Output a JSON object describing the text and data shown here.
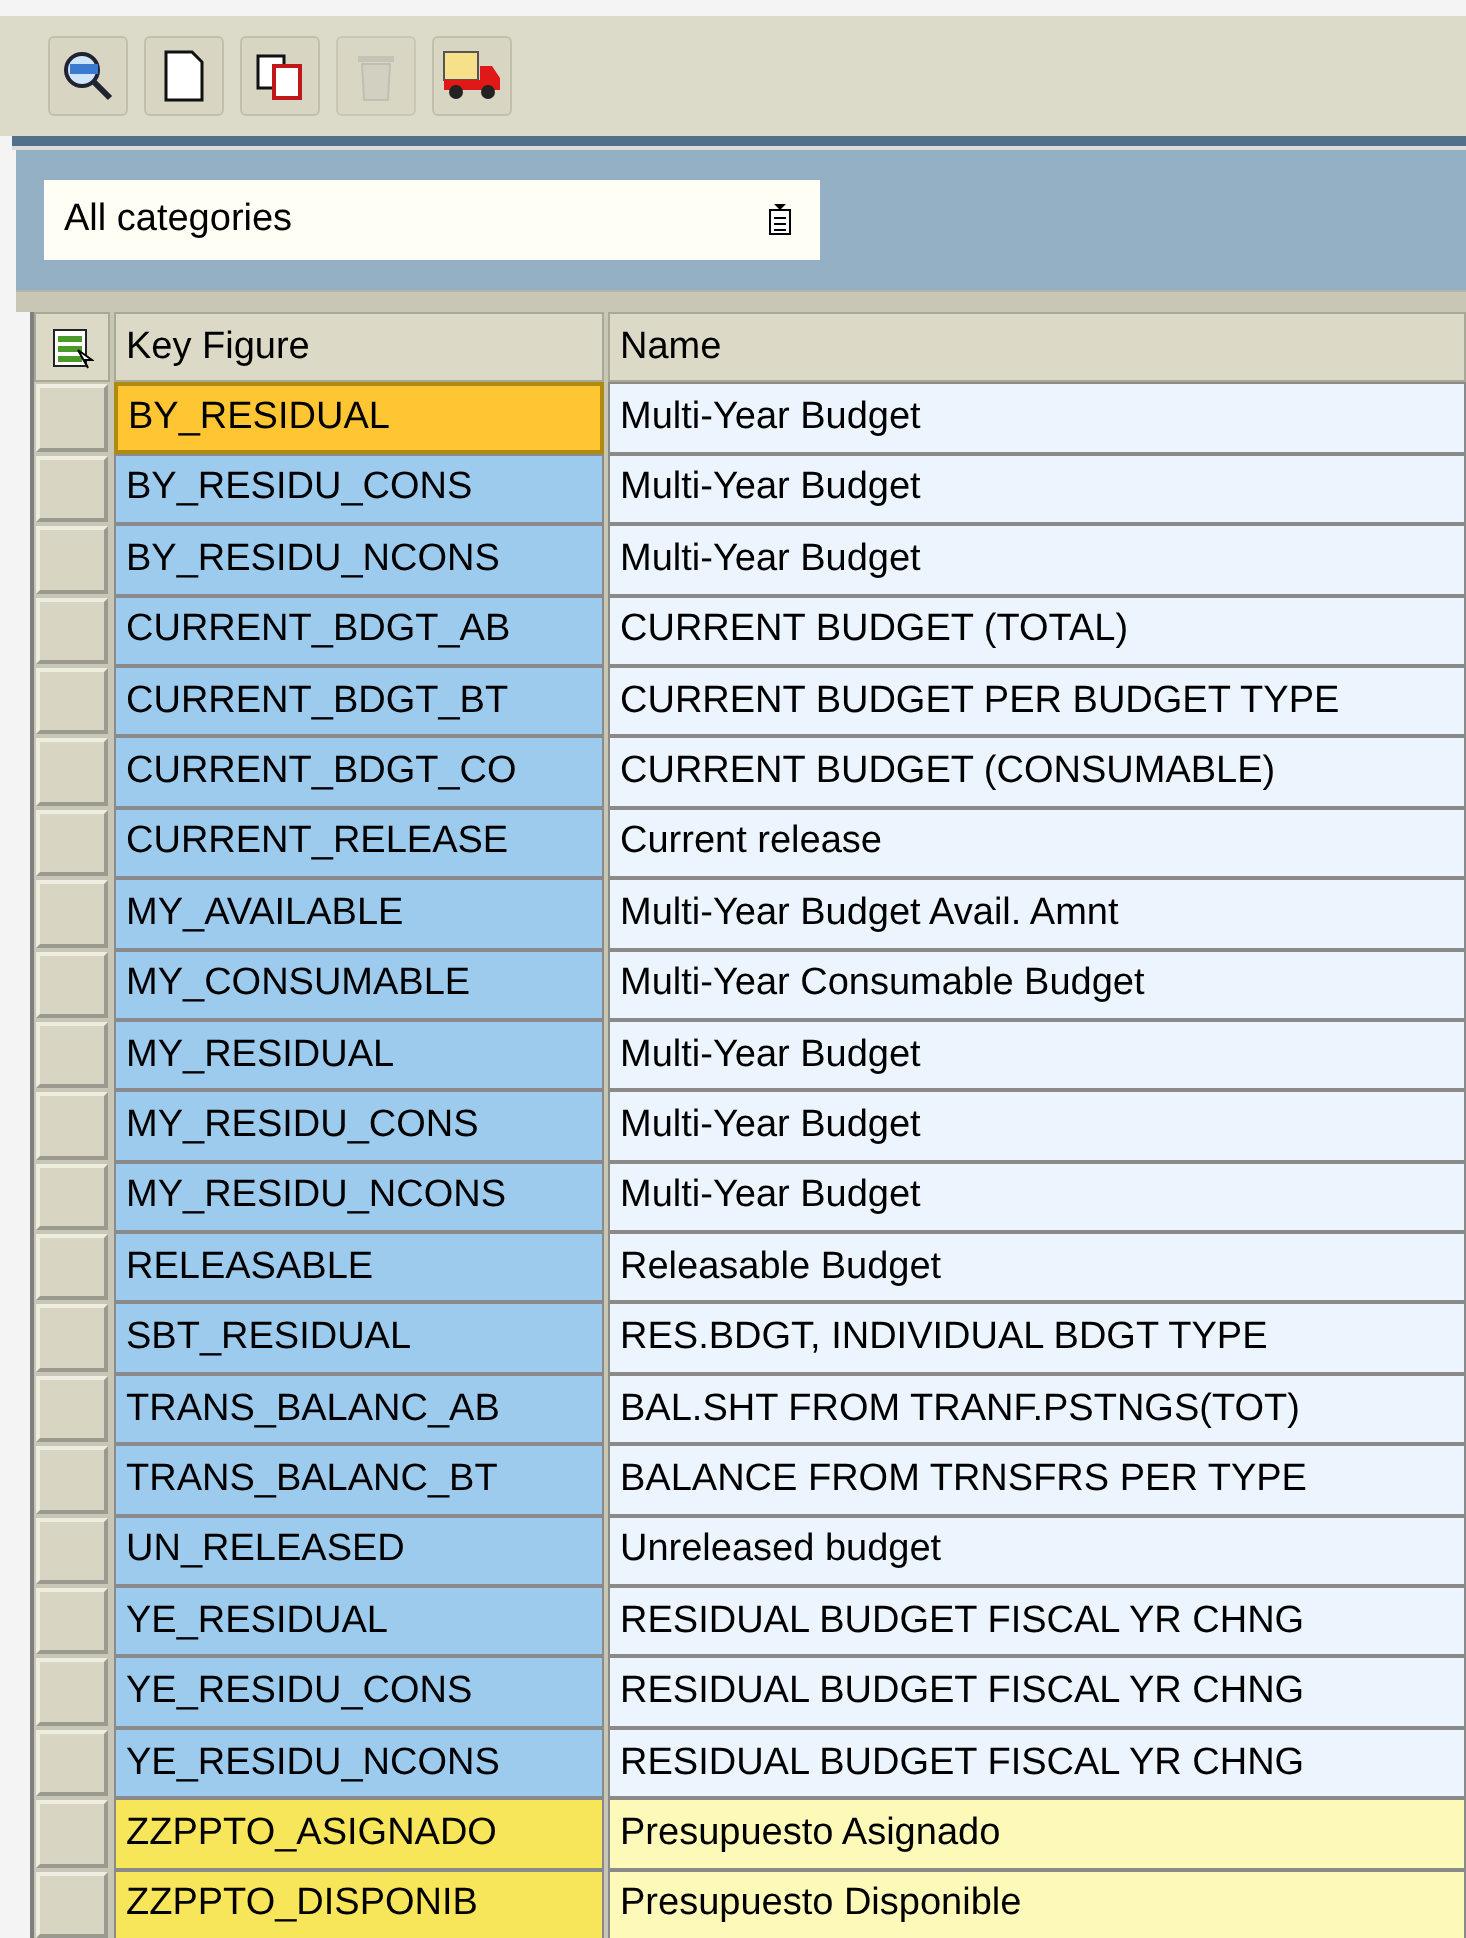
{
  "toolbar": {
    "buttons": [
      {
        "kind": "find",
        "disabled": false
      },
      {
        "kind": "new",
        "disabled": false
      },
      {
        "kind": "copy",
        "disabled": false
      },
      {
        "kind": "delete",
        "disabled": true
      },
      {
        "kind": "transport",
        "disabled": false
      }
    ]
  },
  "filter": {
    "value": "All categories"
  },
  "table": {
    "columns": [
      "Key Figure",
      "Name"
    ],
    "rows": [
      {
        "key": "BY_RESIDUAL",
        "name": "Multi-Year Budget",
        "selected": true,
        "kind": "standard"
      },
      {
        "key": "BY_RESIDU_CONS",
        "name": "Multi-Year Budget",
        "selected": false,
        "kind": "standard"
      },
      {
        "key": "BY_RESIDU_NCONS",
        "name": "Multi-Year Budget",
        "selected": false,
        "kind": "standard"
      },
      {
        "key": "CURRENT_BDGT_AB",
        "name": "CURRENT BUDGET (TOTAL)",
        "selected": false,
        "kind": "standard"
      },
      {
        "key": "CURRENT_BDGT_BT",
        "name": "CURRENT BUDGET PER BUDGET TYPE",
        "selected": false,
        "kind": "standard"
      },
      {
        "key": "CURRENT_BDGT_CO",
        "name": "CURRENT BUDGET (CONSUMABLE)",
        "selected": false,
        "kind": "standard"
      },
      {
        "key": "CURRENT_RELEASE",
        "name": "Current release",
        "selected": false,
        "kind": "standard"
      },
      {
        "key": "MY_AVAILABLE",
        "name": "Multi-Year Budget Avail. Amnt",
        "selected": false,
        "kind": "standard"
      },
      {
        "key": "MY_CONSUMABLE",
        "name": "Multi-Year Consumable Budget",
        "selected": false,
        "kind": "standard"
      },
      {
        "key": "MY_RESIDUAL",
        "name": "Multi-Year Budget",
        "selected": false,
        "kind": "standard"
      },
      {
        "key": "MY_RESIDU_CONS",
        "name": "Multi-Year Budget",
        "selected": false,
        "kind": "standard"
      },
      {
        "key": "MY_RESIDU_NCONS",
        "name": "Multi-Year Budget",
        "selected": false,
        "kind": "standard"
      },
      {
        "key": "RELEASABLE",
        "name": "Releasable Budget",
        "selected": false,
        "kind": "standard"
      },
      {
        "key": "SBT_RESIDUAL",
        "name": "RES.BDGT, INDIVIDUAL BDGT TYPE",
        "selected": false,
        "kind": "standard"
      },
      {
        "key": "TRANS_BALANC_AB",
        "name": "BAL.SHT FROM TRANF.PSTNGS(TOT)",
        "selected": false,
        "kind": "standard"
      },
      {
        "key": "TRANS_BALANC_BT",
        "name": "BALANCE FROM TRNSFRS PER TYPE",
        "selected": false,
        "kind": "standard"
      },
      {
        "key": "UN_RELEASED",
        "name": "Unreleased budget",
        "selected": false,
        "kind": "standard"
      },
      {
        "key": "YE_RESIDUAL",
        "name": "RESIDUAL BUDGET FISCAL YR CHNG",
        "selected": false,
        "kind": "standard"
      },
      {
        "key": "YE_RESIDU_CONS",
        "name": "RESIDUAL BUDGET FISCAL YR CHNG",
        "selected": false,
        "kind": "standard"
      },
      {
        "key": "YE_RESIDU_NCONS",
        "name": "RESIDUAL BUDGET FISCAL YR CHNG",
        "selected": false,
        "kind": "standard"
      },
      {
        "key": "ZZPPTO_ASIGNADO",
        "name": "Presupuesto Asignado",
        "selected": false,
        "kind": "custom"
      },
      {
        "key": "ZZPPTO_DISPONIB",
        "name": "Presupuesto Disponible",
        "selected": false,
        "kind": "custom"
      }
    ]
  }
}
